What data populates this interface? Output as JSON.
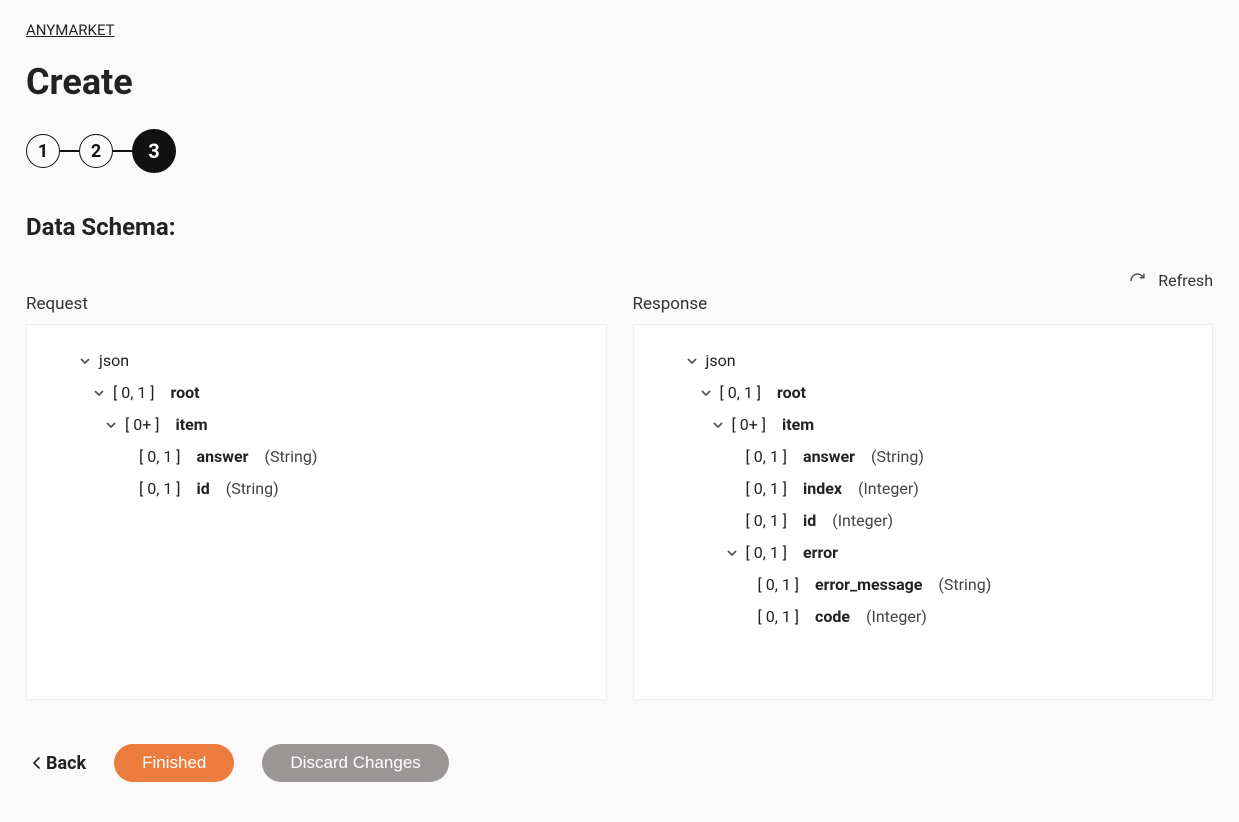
{
  "header": {
    "breadcrumb": "ANYMARKET",
    "title": "Create"
  },
  "stepper": {
    "steps": [
      "1",
      "2",
      "3"
    ],
    "active_index": 2
  },
  "section": {
    "title": "Data Schema:",
    "refresh_label": "Refresh"
  },
  "panels": {
    "request": {
      "title": "Request"
    },
    "response": {
      "title": "Response"
    }
  },
  "tree_labels": {
    "json": "json",
    "root_card": "[ 0, 1 ]",
    "root_name": "root",
    "item_card": "[ 0+ ]",
    "item_name": "item",
    "answer_card": "[ 0, 1 ]",
    "answer_name": "answer",
    "answer_type": "(String)",
    "id_card_req": "[ 0, 1 ]",
    "id_name_req": "id",
    "id_type_req": "(String)",
    "index_card": "[ 0, 1 ]",
    "index_name": "index",
    "index_type": "(Integer)",
    "id_card_res": "[ 0, 1 ]",
    "id_name_res": "id",
    "id_type_res": "(Integer)",
    "error_card": "[ 0, 1 ]",
    "error_name": "error",
    "errmsg_card": "[ 0, 1 ]",
    "errmsg_name": "error_message",
    "errmsg_type": "(String)",
    "code_card": "[ 0, 1 ]",
    "code_name": "code",
    "code_type": "(Integer)"
  },
  "footer": {
    "back": "Back",
    "finished": "Finished",
    "discard": "Discard Changes"
  },
  "colors": {
    "accent": "#eb7c3e",
    "muted_btn": "#9a9696"
  }
}
